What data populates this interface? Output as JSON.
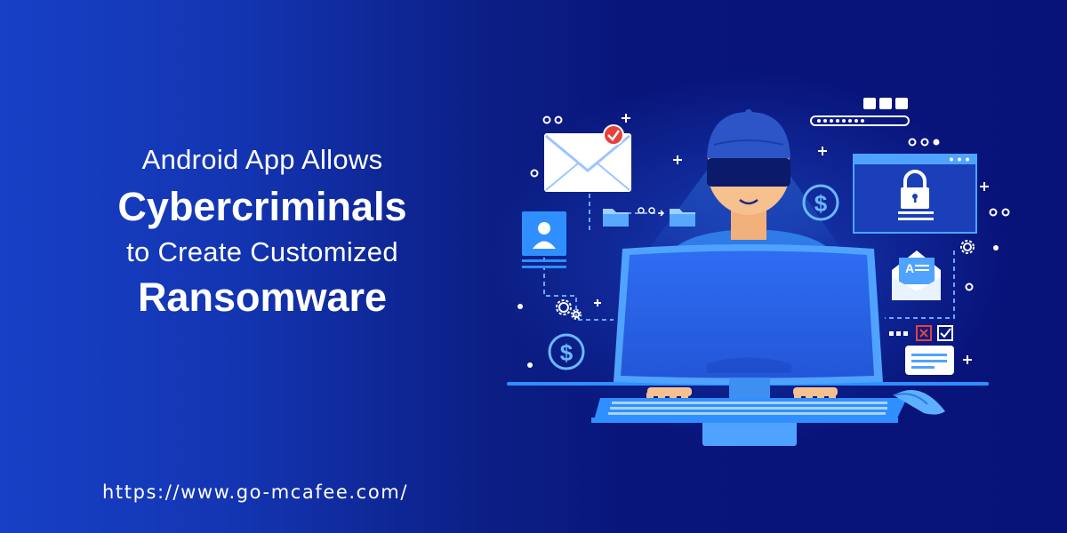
{
  "headline": {
    "line1": "Android App Allows",
    "line2": "Cybercriminals",
    "line3": "to Create Customized",
    "line4": "Ransomware"
  },
  "footer": {
    "url": "https://www.go-mcafee.com/"
  },
  "illustration": {
    "dollar_symbol": "$",
    "mail_badge_letter": "A"
  },
  "colors": {
    "background_left": "#1740c6",
    "background_right": "#08137a",
    "accent_blue": "#2f8fff",
    "screen_blue": "#2a63ee",
    "text": "#ffffff",
    "alert_red": "#e8413b"
  }
}
